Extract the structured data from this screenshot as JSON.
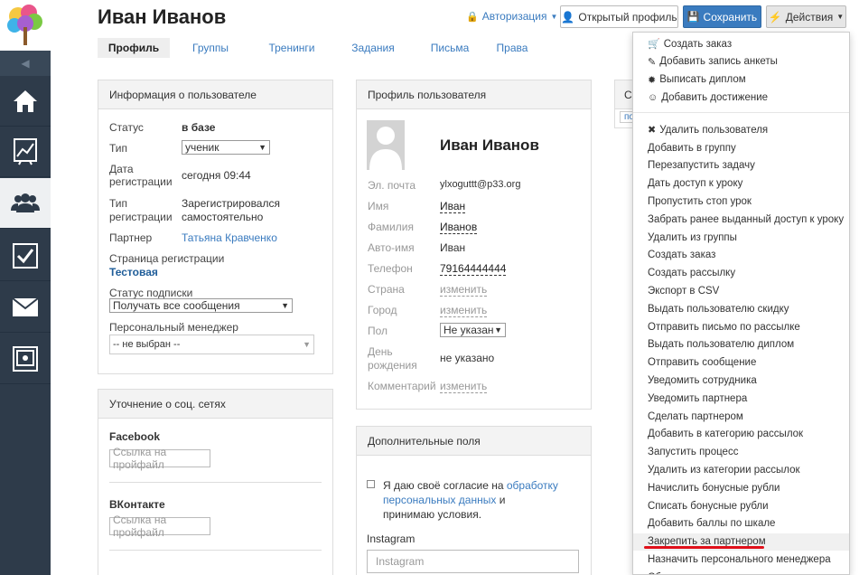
{
  "header": {
    "title": "Иван Иванов",
    "auth_label": "Авторизация",
    "open_profile_label": "Открытый профиль",
    "save_label": "Сохранить",
    "actions_label": "Действия"
  },
  "tabs": [
    "Профиль",
    "Группы",
    "Тренинги",
    "Задания",
    "Письма",
    "Права"
  ],
  "user_info": {
    "title": "Информация о пользователе",
    "status_label": "Статус",
    "status_value": "в базе",
    "type_label": "Тип",
    "type_value": "ученик",
    "reg_date_label_1": "Дата",
    "reg_date_label_2": "регистрации",
    "reg_date_value": "сегодня 09:44",
    "reg_type_label_1": "Тип",
    "reg_type_label_2": "регистрации",
    "reg_type_value_1": "Зарегистрировался",
    "reg_type_value_2": "самостоятельно",
    "partner_label": "Партнер",
    "partner_value": "Татьяна Кравченко",
    "reg_page_label": "Страница регистрации",
    "reg_page_value": "Тестовая",
    "subscription_label": "Статус подписки",
    "subscription_value": "Получать все сообщения",
    "manager_label": "Персональный менеджер",
    "manager_value": "-- не выбран --"
  },
  "social": {
    "title": "Уточнение о соц. сетях",
    "facebook_label": "Facebook",
    "facebook_placeholder": "Ссылка на пройфайл",
    "vk_label": "ВКонтакте",
    "vk_placeholder": "Ссылка на пройфайл"
  },
  "profile": {
    "title": "Профиль пользователя",
    "name": "Иван Иванов",
    "email_label": "Эл. почта",
    "email_value": "ylxoguttt@p33.org",
    "first_name_label": "Имя",
    "first_name_value": "Иван",
    "last_name_label": "Фамилия",
    "last_name_value": "Иванов",
    "auto_name_label": "Авто-имя",
    "auto_name_value": "Иван",
    "phone_label": "Телефон",
    "phone_value": "79164444444",
    "country_label": "Страна",
    "country_value": "изменить",
    "city_label": "Город",
    "city_value": "изменить",
    "gender_label": "Пол",
    "gender_value": "Не указан",
    "birthday_label_1": "День",
    "birthday_label_2": "рождения",
    "birthday_value": "не указано",
    "comment_label": "Комментарий",
    "comment_value": "изменить"
  },
  "extra": {
    "title": "Дополнительные поля",
    "consent_text_1": "Я даю своё согласие на ",
    "consent_link_1": "обработку",
    "consent_link_2": "персональных данных",
    "consent_text_2": " и принимаю",
    "consent_text_3": "условия.",
    "instagram_label": "Instagram",
    "instagram_placeholder": "Instagram"
  },
  "hidden_panel": {
    "title_fragment": "Сі",
    "link_fragment": "по"
  },
  "actions_menu": {
    "group1": [
      {
        "icon": "cart-icon",
        "glyph": "🛒",
        "label": "Создать заказ"
      },
      {
        "icon": "pencil-icon",
        "glyph": "✎",
        "label": "Добавить запись анкеты"
      },
      {
        "icon": "certificate-icon",
        "glyph": "✹",
        "label": "Выписать диплом"
      },
      {
        "icon": "smile-icon",
        "glyph": "☺",
        "label": "Добавить достижение"
      }
    ],
    "group2": [
      {
        "icon": "delete-icon",
        "glyph": "✖",
        "label": "Удалить пользователя"
      },
      {
        "label": "Добавить в группу"
      },
      {
        "label": "Перезапустить задачу"
      },
      {
        "label": "Дать доступ к уроку"
      },
      {
        "label": "Пропустить стоп урок"
      },
      {
        "label": "Забрать ранее выданный доступ к уроку"
      },
      {
        "label": "Удалить из группы"
      },
      {
        "label": "Создать заказ"
      },
      {
        "label": "Создать рассылку"
      },
      {
        "label": "Экспорт в CSV"
      },
      {
        "label": "Выдать пользователю скидку"
      },
      {
        "label": "Отправить письмо по рассылке"
      },
      {
        "label": "Выдать пользователю диплом"
      },
      {
        "label": "Отправить сообщение"
      },
      {
        "label": "Уведомить сотрудника"
      },
      {
        "label": "Уведомить партнера"
      },
      {
        "label": "Сделать партнером"
      },
      {
        "label": "Добавить в категорию рассылок"
      },
      {
        "label": "Запустить процесс"
      },
      {
        "label": "Удалить из категории рассылок"
      },
      {
        "label": "Начислить бонусные рубли"
      },
      {
        "label": "Списать бонусные рубли"
      },
      {
        "label": "Добавить баллы по шкале"
      },
      {
        "label": "Закрепить за партнером"
      },
      {
        "label": "Назначить персонального менеджера"
      },
      {
        "label": "Сбросить персонального менеджера"
      }
    ],
    "highlighted_index": 23
  },
  "colors": {
    "sidebar": "#2e3b4a",
    "link": "#3a7bbf",
    "primary": "#3a7bbf",
    "marker": "#e0101a"
  }
}
